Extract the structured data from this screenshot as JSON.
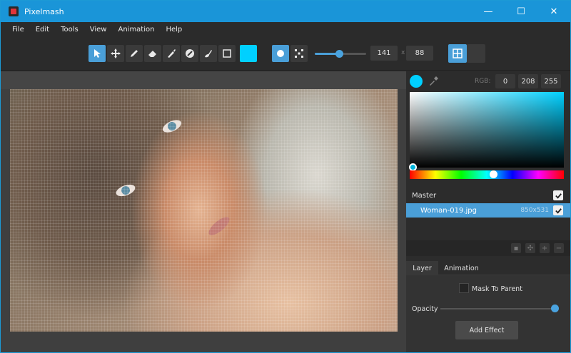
{
  "window": {
    "title": "Pixelmash",
    "minimize": "—",
    "maximize": "☐",
    "close": "✕"
  },
  "menu": [
    "File",
    "Edit",
    "Tools",
    "View",
    "Animation",
    "Help"
  ],
  "toolbar": {
    "tools": [
      "select",
      "move",
      "pencil",
      "eraser",
      "brush",
      "fill",
      "smudge",
      "rectangle"
    ],
    "active_tool": "select",
    "primary_color": "#00d0ff",
    "brush_shapes": [
      "circle",
      "dither"
    ],
    "width": "141",
    "times": "x",
    "height": "88",
    "slider_value": 0.47
  },
  "canvas": {
    "image": "Woman portrait (pixelated)",
    "grid": true
  },
  "color_panel": {
    "rgb_label": "RGB:",
    "r": "0",
    "g": "208",
    "b": "255",
    "hue_position": 0.52
  },
  "layers": {
    "master_label": "Master",
    "items": [
      {
        "name": "Woman-019.jpg",
        "size": "850x531",
        "visible": true
      }
    ]
  },
  "tabs": {
    "layer": "Layer",
    "animation": "Animation"
  },
  "layer_props": {
    "mask_label": "Mask To Parent",
    "opacity_label": "Opacity",
    "opacity": 1.0,
    "add_effect": "Add Effect"
  }
}
